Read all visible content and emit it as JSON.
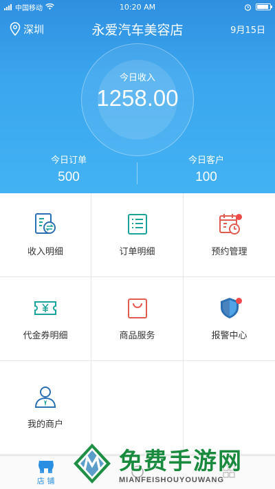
{
  "status_bar": {
    "carrier": "中国移动",
    "time": "10:20 AM"
  },
  "header": {
    "location": "深圳",
    "title": "永爱汽车美容店",
    "date": "9月15日"
  },
  "income": {
    "label": "今日收入",
    "value": "1258.00"
  },
  "stats": [
    {
      "label": "今日订单",
      "value": "500"
    },
    {
      "label": "今日客户",
      "value": "100"
    }
  ],
  "menu": [
    {
      "label": "收入明细",
      "icon": "income-detail-icon",
      "badge": false
    },
    {
      "label": "订单明细",
      "icon": "order-list-icon",
      "badge": false
    },
    {
      "label": "预约管理",
      "icon": "calendar-clock-icon",
      "badge": true
    },
    {
      "label": "代金券明细",
      "icon": "voucher-icon",
      "badge": false
    },
    {
      "label": "商品服务",
      "icon": "shopping-bag-icon",
      "badge": false
    },
    {
      "label": "报警中心",
      "icon": "shield-icon",
      "badge": true
    },
    {
      "label": "我的商户",
      "icon": "user-icon",
      "badge": false
    }
  ],
  "tabs": [
    {
      "label": "店 铺",
      "active": true
    },
    {
      "label": "",
      "active": false
    },
    {
      "label": "",
      "active": false
    }
  ],
  "watermark": {
    "title": "免费手游网",
    "subtitle": "MIANFEISHOUYOUWANG"
  },
  "colors": {
    "header_blue": "#3aa6ee",
    "active_tab": "#2a8fe0",
    "badge_red": "#f04a4a",
    "teal": "#1aa39a",
    "red_icon": "#e35a4f"
  }
}
